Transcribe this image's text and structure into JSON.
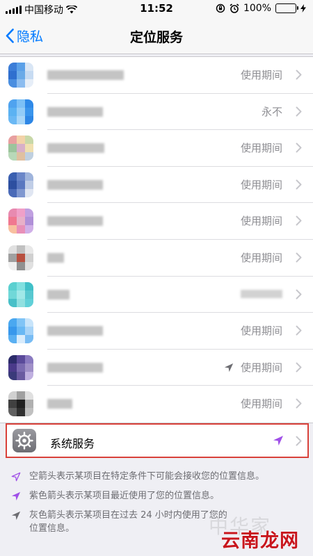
{
  "status_bar": {
    "carrier": "中国移动",
    "time": "11:52",
    "battery": "100%",
    "battery_level": 1.0
  },
  "nav": {
    "back_label": "隐私",
    "title": "定位服务"
  },
  "apps": [
    {
      "status": "使用期间",
      "icon_colors": [
        "#3b7dd8",
        "#5aa0e8",
        "#d9e6f5",
        "#2f6fcf",
        "#6aaae8",
        "#c7dbf2",
        "#4a8ee0",
        "#8bbcf0",
        "#e6eef8"
      ],
      "name_width": 110,
      "arrow": false
    },
    {
      "status": "永不",
      "icon_colors": [
        "#4fa3ef",
        "#7cc0f6",
        "#2f8ae8",
        "#5bb2f2",
        "#93ccf7",
        "#3a95ec",
        "#6ab8f4",
        "#a8d6f8",
        "#2d86e5"
      ],
      "name_width": 80,
      "arrow": false
    },
    {
      "status": "使用期间",
      "icon_colors": [
        "#e8a0a0",
        "#f2d2a8",
        "#c8d8a8",
        "#9cc49c",
        "#d8b0c8",
        "#f0e0b0",
        "#b8d8b8",
        "#e0c0a0",
        "#c0d0e0"
      ],
      "name_width": 82,
      "arrow": false
    },
    {
      "status": "使用期间",
      "icon_colors": [
        "#3a5fb0",
        "#6a86c8",
        "#9fb4dc",
        "#2d4fa0",
        "#5a78c0",
        "#c0cde6",
        "#4a6ab8",
        "#7f97d0",
        "#e0e6f2"
      ],
      "name_width": 80,
      "arrow": false
    },
    {
      "status": "使用期间",
      "icon_colors": [
        "#e88ab0",
        "#f0a0c8",
        "#c0a0e0",
        "#f07890",
        "#e8b0c8",
        "#b090d8",
        "#f8c0a0",
        "#e890b8",
        "#d0b0e8"
      ],
      "name_width": 80,
      "arrow": false
    },
    {
      "status": "使用期间",
      "icon_colors": [
        "#e0e0e0",
        "#c0c0c0",
        "#e8e8e8",
        "#a0a0a0",
        "#b85040",
        "#d0d0d0",
        "#f0f0f0",
        "#909090",
        "#e0e0e0"
      ],
      "name_width": 24,
      "arrow": false
    },
    {
      "status": "",
      "icon_colors": [
        "#5ad0d0",
        "#80e0e0",
        "#40c0c8",
        "#70d8d8",
        "#a0e8e8",
        "#58c8d0",
        "#48c0c8",
        "#90e0e0",
        "#60d0d8"
      ],
      "name_width": 32,
      "arrow": false
    },
    {
      "status": "使用期间",
      "icon_colors": [
        "#4aa8f0",
        "#80c4f6",
        "#c8e4fa",
        "#3898ec",
        "#68b8f4",
        "#a8d4f8",
        "#5ab0f2",
        "#d8ecfc",
        "#78bcf4"
      ],
      "name_width": 80,
      "arrow": false
    },
    {
      "status": "使用期间",
      "icon_colors": [
        "#2c2c6a",
        "#5a4a9a",
        "#8a7ac0",
        "#4a3a8a",
        "#7a6ab0",
        "#a090c8",
        "#3a3a7a",
        "#6a5aa0",
        "#c0b0e0"
      ],
      "name_width": 80,
      "arrow": true
    },
    {
      "status": "使用期间",
      "icon_colors": [
        "#d0d0d0",
        "#a0a0a0",
        "#e0e0e0",
        "#404040",
        "#202020",
        "#b0b0b0",
        "#606060",
        "#303030",
        "#c0c0c0"
      ],
      "name_width": 36,
      "arrow": false
    }
  ],
  "system_services": {
    "label": "系统服务"
  },
  "legend": {
    "hollow": "空箭头表示某项目在特定条件下可能会接收您的位置信息。",
    "purple": "紫色箭头表示某项目最近使用了您的位置信息。",
    "gray_line1": "灰色箭头表示某项目在过去 24 小时内使用了您的",
    "gray_line2": "位置信息。"
  },
  "watermark": {
    "text": "云南龙网",
    "faded_text": "中华家"
  },
  "colors": {
    "accent": "#007aff",
    "highlight_border": "#d9413a",
    "purple_arrow": "#a050e8",
    "gray_arrow": "#6d6d72",
    "watermark_red": "#c8161d"
  }
}
